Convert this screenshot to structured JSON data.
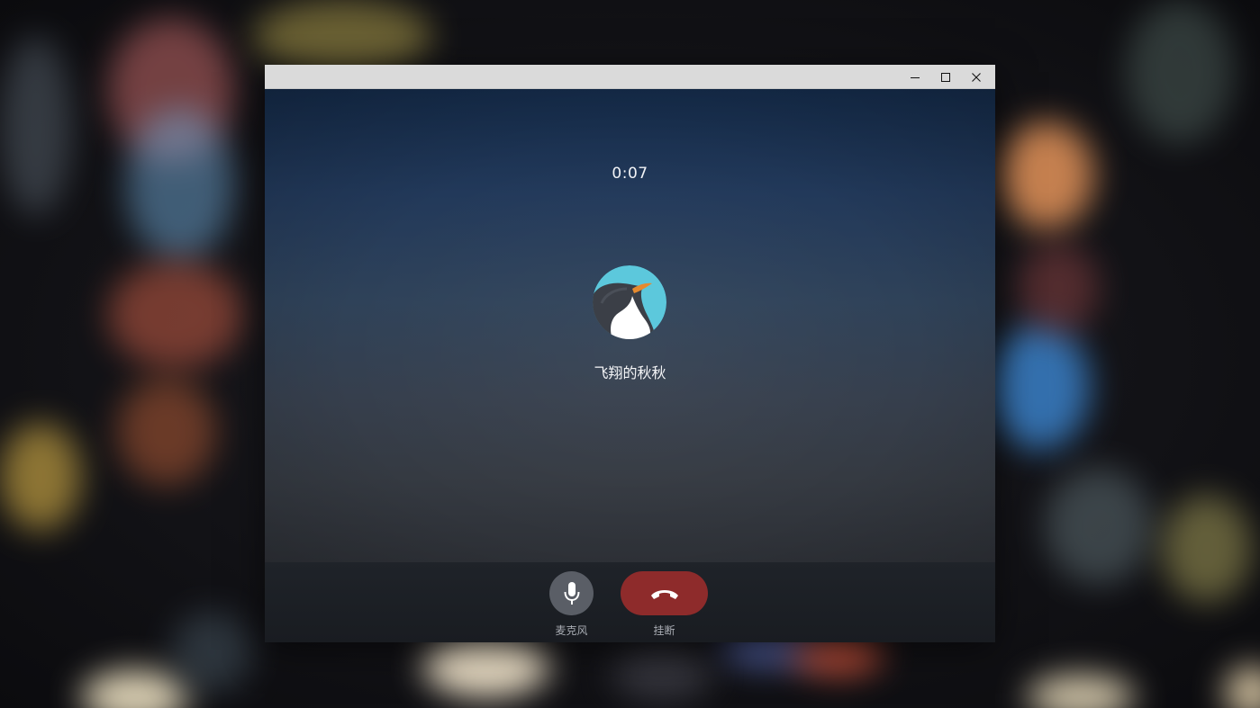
{
  "window": {
    "controls": {
      "minimize_icon": "minimize-icon",
      "maximize_icon": "maximize-icon",
      "close_icon": "close-icon"
    }
  },
  "call": {
    "duration": "0:07",
    "contact_name": "飞翔的秋秋",
    "avatar_icon": "penguin-avatar"
  },
  "controls": {
    "mic_label": "麦克风",
    "hangup_label": "挂断",
    "mic_icon": "microphone-icon",
    "hangup_icon": "phone-hangup-icon"
  },
  "colors": {
    "titlebar": "#dadada",
    "hangup": "#8e2b2b",
    "mic_button": "#5a5e66",
    "avatar_bg": "#5cc8dc"
  }
}
